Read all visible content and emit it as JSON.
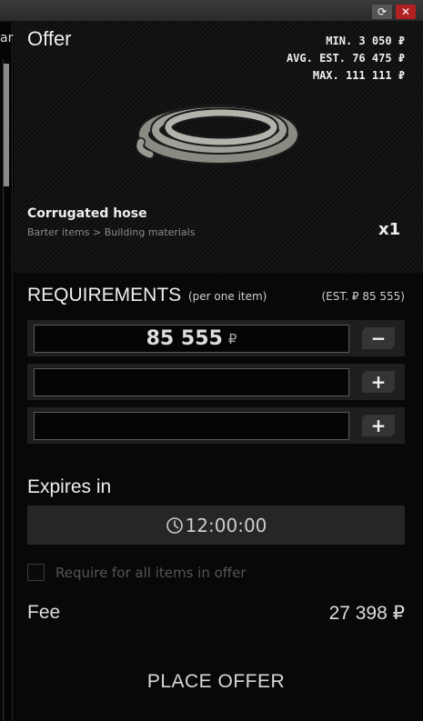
{
  "window": {
    "refresh_icon": "refresh-icon",
    "close_icon": "close-icon",
    "close_glyph": "✕",
    "refresh_glyph": "⟳"
  },
  "left_panel": {
    "text": "ar"
  },
  "offer": {
    "title": "Offer",
    "min": "MIN. 3 050 ₽",
    "avg": "AVG. EST. 76 475 ₽",
    "max": "MAX. 111 111 ₽"
  },
  "item": {
    "name": "Corrugated hose",
    "category": "Barter items > Building materials",
    "quantity": "x1"
  },
  "requirements": {
    "title": "REQUIREMENTS",
    "subtitle": "(per one item)",
    "estimate": "(EST. ₽ 85 555)",
    "rows": [
      {
        "value": "85 555",
        "currency": "₽",
        "button": "−"
      },
      {
        "value": "",
        "currency": "",
        "button": "+"
      },
      {
        "value": "",
        "currency": "",
        "button": "+"
      }
    ]
  },
  "expires": {
    "title": "Expires in",
    "time": "12:00:00"
  },
  "require_all": {
    "label": "Require for all items in offer",
    "checked": false
  },
  "fee": {
    "label": "Fee",
    "value": "27 398 ₽"
  },
  "place_offer": {
    "label": "PLACE OFFER"
  }
}
